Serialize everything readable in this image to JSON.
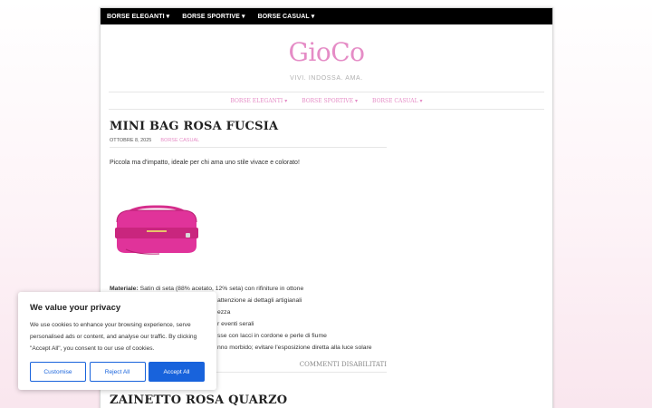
{
  "topbar": {
    "items": [
      "BORSE ELEGANTI ▾",
      "BORSE SPORTIVE ▾",
      "BORSE CASUAL ▾"
    ]
  },
  "site": {
    "title": "GioCo",
    "tagline": "VIVI. INDOSSA. AMA."
  },
  "main_nav": {
    "items": [
      "BORSE ELEGANTI ▾",
      "BORSE SPORTIVE ▾",
      "BORSE CASUAL ▾"
    ]
  },
  "post": {
    "title": "MINI BAG ROSA FUCSIA",
    "date": "OTTOBRE 8, 2025",
    "category": "BORSE CASUAL",
    "intro": "Piccola ma d'impatto, ideale per chi ama uno stile vivace e colorato!",
    "specs": [
      {
        "label": "Materiale:",
        "text": " Satin di seta (88% acetato, 12% seta) con rifiniture in ottone"
      },
      {
        "label": "",
        "text": "attenzione ai dettagli artigianali"
      },
      {
        "label": "",
        "text": "ezza"
      },
      {
        "label": "",
        "text": "r eventi serali"
      },
      {
        "label": "",
        "text": "sse con lacci in cordone e perle di fiume"
      },
      {
        "label": "",
        "text": "nno morbido; evitare l'esposizione diretta alla luce solare"
      }
    ],
    "comments": "COMMENTI DISABILITATI"
  },
  "next_post": {
    "title": "ZAINETTO ROSA QUARZO"
  },
  "cookie_banner": {
    "title": "We value your privacy",
    "text": "We use cookies to enhance your browsing experience, serve personalised ads or content, and analyse our traffic. By clicking \"Accept All\", you consent to our use of cookies.",
    "customise": "Customise",
    "reject": "Reject All",
    "accept": "Accept All"
  },
  "colors": {
    "accent": "#e58cc6",
    "bag": "#e0339a",
    "button": "#1863dc"
  },
  "icons": [
    "handbag-image"
  ]
}
